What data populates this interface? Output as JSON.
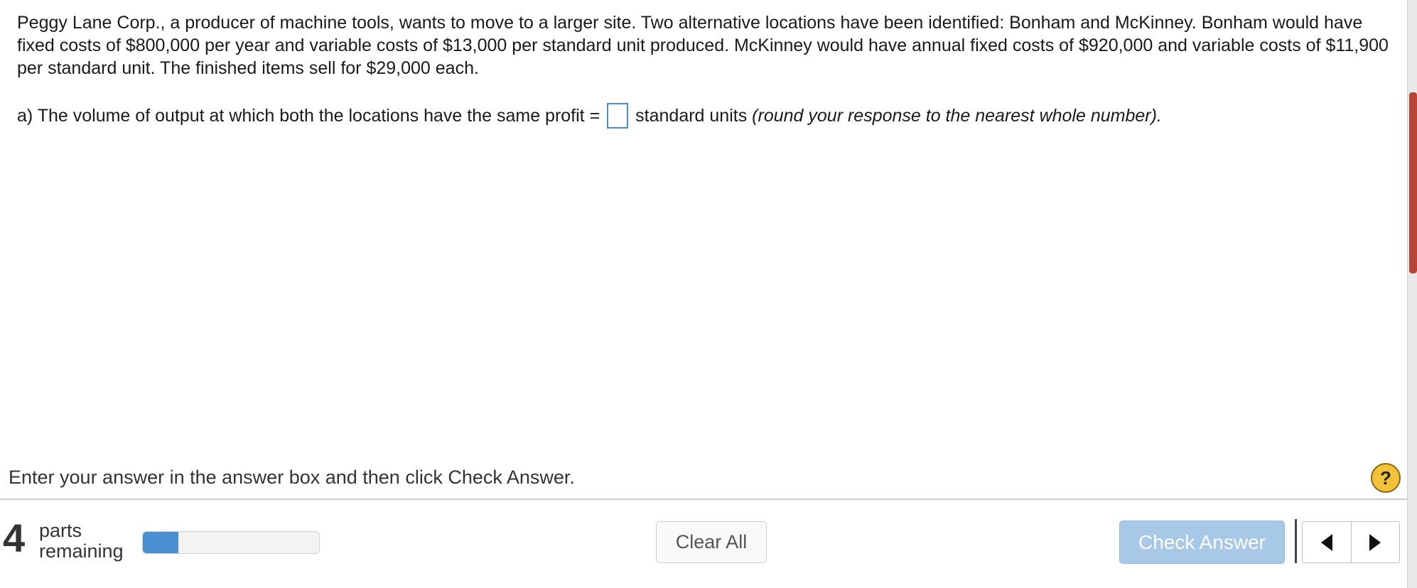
{
  "question": {
    "problem_text": "Peggy Lane Corp., a producer of machine tools, wants to move to a larger site. Two alternative locations have been identified: Bonham and McKinney. Bonham would have fixed costs of $800,000 per year and variable costs of $13,000 per standard unit produced. McKinney would have annual fixed costs of $920,000 and variable costs of $11,900 per standard unit. The finished items sell for $29,000 each.",
    "part_a": {
      "prefix": "a) The volume of output at which both the locations have the same profit =",
      "answer_value": "",
      "suffix": "standard units",
      "note": "(round your response to the nearest whole number)."
    }
  },
  "footer": {
    "instruction": "Enter your answer in the answer box and then click Check Answer.",
    "help_label": "?",
    "parts_count": "4",
    "parts_label_line1": "parts",
    "parts_label_line2": "remaining",
    "progress_fraction": 0.2,
    "clear_all_label": "Clear All",
    "check_answer_label": "Check Answer",
    "icons": {
      "prev": "triangle-left-icon",
      "next": "triangle-right-icon",
      "help": "question-mark-icon"
    }
  },
  "colors": {
    "accent": "#4a8fcf",
    "check_answer_disabled": "#a7c8e6",
    "help_yellow": "#f2c23a"
  }
}
